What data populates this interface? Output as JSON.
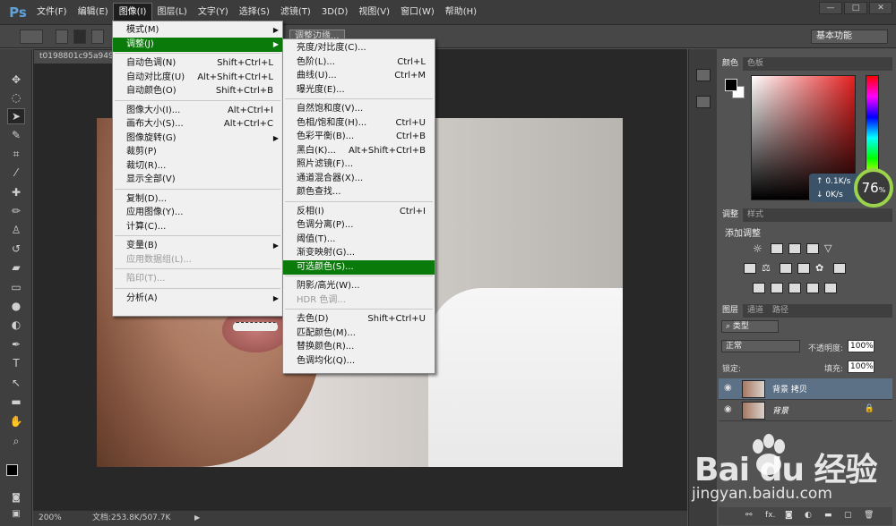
{
  "app": {
    "logo": "Ps",
    "menus": [
      "文件(F)",
      "编辑(E)",
      "图像(I)",
      "图层(L)",
      "文字(Y)",
      "选择(S)",
      "滤镜(T)",
      "3D(D)",
      "视图(V)",
      "窗口(W)",
      "帮助(H)"
    ],
    "active_menu_index": 2,
    "window_controls": [
      "—",
      "□",
      "✕"
    ]
  },
  "options_bar": {
    "refine_edge": "调整边缘...",
    "workspace": "基本功能"
  },
  "document": {
    "tab": "t0198801c95a949",
    "zoom": "200%",
    "doc_info": "文档:253.8K/507.7K"
  },
  "image_menu": {
    "items": [
      {
        "label": "模式(M)",
        "shortcut": "",
        "submenu": true
      },
      {
        "label": "调整(J)",
        "shortcut": "",
        "submenu": true,
        "highlight": true
      },
      {
        "sep": true
      },
      {
        "label": "自动色调(N)",
        "shortcut": "Shift+Ctrl+L"
      },
      {
        "label": "自动对比度(U)",
        "shortcut": "Alt+Shift+Ctrl+L"
      },
      {
        "label": "自动颜色(O)",
        "shortcut": "Shift+Ctrl+B"
      },
      {
        "sep": true
      },
      {
        "label": "图像大小(I)...",
        "shortcut": "Alt+Ctrl+I"
      },
      {
        "label": "画布大小(S)...",
        "shortcut": "Alt+Ctrl+C"
      },
      {
        "label": "图像旋转(G)",
        "shortcut": "",
        "submenu": true
      },
      {
        "label": "裁剪(P)",
        "shortcut": ""
      },
      {
        "label": "裁切(R)...",
        "shortcut": ""
      },
      {
        "label": "显示全部(V)",
        "shortcut": ""
      },
      {
        "sep": true
      },
      {
        "label": "复制(D)...",
        "shortcut": ""
      },
      {
        "label": "应用图像(Y)...",
        "shortcut": ""
      },
      {
        "label": "计算(C)...",
        "shortcut": ""
      },
      {
        "sep": true
      },
      {
        "label": "变量(B)",
        "shortcut": "",
        "submenu": true
      },
      {
        "label": "应用数据组(L)...",
        "shortcut": "",
        "disabled": true
      },
      {
        "sep": true
      },
      {
        "label": "陷印(T)...",
        "shortcut": "",
        "disabled": true
      },
      {
        "sep": true
      },
      {
        "label": "分析(A)",
        "shortcut": "",
        "submenu": true
      }
    ]
  },
  "adjust_menu": {
    "items": [
      {
        "label": "亮度/对比度(C)...",
        "shortcut": ""
      },
      {
        "label": "色阶(L)...",
        "shortcut": "Ctrl+L"
      },
      {
        "label": "曲线(U)...",
        "shortcut": "Ctrl+M"
      },
      {
        "label": "曝光度(E)...",
        "shortcut": ""
      },
      {
        "sep": true
      },
      {
        "label": "自然饱和度(V)...",
        "shortcut": ""
      },
      {
        "label": "色相/饱和度(H)...",
        "shortcut": "Ctrl+U"
      },
      {
        "label": "色彩平衡(B)...",
        "shortcut": "Ctrl+B"
      },
      {
        "label": "黑白(K)...",
        "shortcut": "Alt+Shift+Ctrl+B"
      },
      {
        "label": "照片滤镜(F)...",
        "shortcut": ""
      },
      {
        "label": "通道混合器(X)...",
        "shortcut": ""
      },
      {
        "label": "颜色查找...",
        "shortcut": ""
      },
      {
        "sep": true
      },
      {
        "label": "反相(I)",
        "shortcut": "Ctrl+I"
      },
      {
        "label": "色调分离(P)...",
        "shortcut": ""
      },
      {
        "label": "阈值(T)...",
        "shortcut": ""
      },
      {
        "label": "渐变映射(G)...",
        "shortcut": ""
      },
      {
        "label": "可选颜色(S)...",
        "shortcut": "",
        "highlight": true
      },
      {
        "sep": true
      },
      {
        "label": "阴影/高光(W)...",
        "shortcut": ""
      },
      {
        "label": "HDR 色调...",
        "shortcut": "",
        "disabled": true
      },
      {
        "sep": true
      },
      {
        "label": "去色(D)",
        "shortcut": "Shift+Ctrl+U"
      },
      {
        "label": "匹配颜色(M)...",
        "shortcut": ""
      },
      {
        "label": "替换颜色(R)...",
        "shortcut": ""
      },
      {
        "label": "色调均化(Q)...",
        "shortcut": ""
      }
    ]
  },
  "color_panel": {
    "tabs": [
      "颜色",
      "色板"
    ],
    "fg_color": "#000000",
    "bg_color": "#ffffff"
  },
  "net_widget": {
    "up": "0.1K/s",
    "down": "0K/s",
    "percent": "76",
    "percent_sign": "%"
  },
  "adjustments_panel": {
    "tabs": [
      "调整",
      "样式"
    ],
    "title": "添加调整"
  },
  "layers_panel": {
    "tabs": [
      "图层",
      "通道",
      "路径"
    ],
    "filter": "类型",
    "blend_mode": "正常",
    "opacity_label": "不透明度:",
    "opacity": "100%",
    "lock_label": "锁定:",
    "fill_label": "填充:",
    "fill": "100%",
    "layers": [
      {
        "name": "背景 拷贝",
        "selected": true,
        "locked": false
      },
      {
        "name": "背景",
        "selected": false,
        "locked": true
      }
    ]
  },
  "watermark": {
    "brand": "Bai du 经验",
    "url": "jingyan.baidu.com"
  }
}
